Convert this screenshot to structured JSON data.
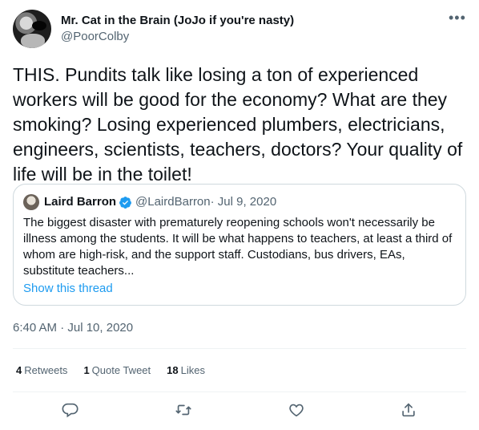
{
  "author": {
    "display_name": "Mr. Cat in the Brain (JoJo if you're nasty)",
    "handle": "@PoorColby",
    "more_glyph": "•••"
  },
  "tweet": {
    "text": "THIS. Pundits talk like losing a ton of experienced workers will be good for the economy? What are they smoking? Losing experienced plumbers, electricians, engineers, scientists, teachers, doctors? Your quality of life will be in the toilet!",
    "timestamp": "6:40 AM · Jul 10, 2020"
  },
  "quoted": {
    "display_name": "Laird Barron",
    "handle": "@LairdBarron",
    "date": " · Jul 9, 2020",
    "text": "The biggest disaster with prematurely reopening schools won't necessarily be illness among the students. It will be what happens to teachers, at least a third of whom are high-risk, and the support staff. Custodians, bus drivers, EAs, substitute teachers...",
    "link_label": "Show this thread"
  },
  "stats": {
    "retweets_count": "4",
    "retweets_label": "Retweets",
    "quotes_count": "1",
    "quotes_label": "Quote Tweet",
    "likes_count": "18",
    "likes_label": "Likes"
  },
  "actions": [
    "reply-icon",
    "retweet-icon",
    "like-icon",
    "share-icon"
  ],
  "colors": {
    "text": "#0f1419",
    "secondary": "#536471",
    "link": "#1d9bf0",
    "border": "#cfd9de"
  }
}
